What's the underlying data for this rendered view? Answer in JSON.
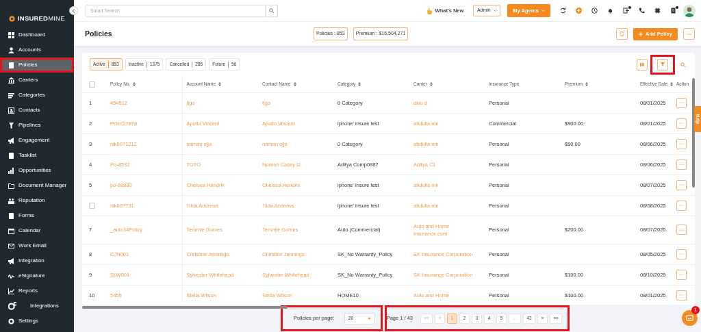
{
  "sidebar": {
    "logo": "**INSURED**MINE",
    "items": [
      {
        "label": "Dashboard",
        "selected": false,
        "highlighted": false
      },
      {
        "label": "Accounts",
        "selected": false,
        "highlighted": false
      },
      {
        "label": "Policies",
        "selected": true,
        "highlighted": true
      },
      {
        "label": "Carriers",
        "selected": false,
        "highlighted": false
      },
      {
        "label": "Categories",
        "selected": false,
        "highlighted": false
      },
      {
        "label": "Contacts",
        "selected": false,
        "highlighted": false
      },
      {
        "label": "Pipelines",
        "selected": false,
        "highlighted": false
      },
      {
        "label": "Engagement",
        "selected": false,
        "highlighted": false
      },
      {
        "label": "Tasklist",
        "selected": false,
        "highlighted": false
      },
      {
        "label": "Opportunities",
        "selected": false,
        "highlighted": false
      },
      {
        "label": "Document Manager",
        "selected": false,
        "highlighted": false
      },
      {
        "label": "Reputation",
        "selected": false,
        "highlighted": false
      },
      {
        "label": "Forms",
        "selected": false,
        "highlighted": false
      },
      {
        "label": "Calendar",
        "selected": false,
        "highlighted": false
      },
      {
        "label": "Work Email",
        "selected": false,
        "highlighted": false
      },
      {
        "label": "Integration",
        "selected": false,
        "highlighted": false
      },
      {
        "label": "eSignature",
        "selected": false,
        "highlighted": false
      },
      {
        "label": "Reports",
        "selected": false,
        "highlighted": false
      },
      {
        "label": "Integrations",
        "selected": false,
        "highlighted": false
      },
      {
        "label": "Settings",
        "selected": false,
        "highlighted": false
      }
    ]
  },
  "topbar": {
    "search": {
      "placeholder": "Smart Search"
    },
    "whats_new": "What's New",
    "role": "Admin",
    "agents_button": "My Agents",
    "notification_dots": [
      false,
      false,
      false,
      false,
      true,
      false,
      false,
      true
    ]
  },
  "header": {
    "title": "Policies",
    "stats": [
      "Policies : 853",
      "Premium : $16,504,271"
    ],
    "add_button": "Add Policy"
  },
  "status_tabs": [
    {
      "label": "Active",
      "count": "853",
      "selected": true
    },
    {
      "label": "Inactive",
      "count": "1375",
      "selected": false
    },
    {
      "label": "Cancelled",
      "count": "285",
      "selected": false
    },
    {
      "label": "Future",
      "count": "56",
      "selected": false
    }
  ],
  "filter_highlighted": true,
  "table": {
    "select_all": {
      "checked": false
    },
    "columns": [
      {
        "label": "Policy No.",
        "sortable": true
      },
      {
        "label": "Account Name",
        "sortable": true
      },
      {
        "label": "Contact Name",
        "sortable": true
      },
      {
        "label": "Category",
        "sortable": true
      },
      {
        "label": "Carrier",
        "sortable": true
      },
      {
        "label": "Insurance Type",
        "sortable": false
      },
      {
        "label": "Premium",
        "sortable": true
      },
      {
        "label": "Effective Date",
        "sortable": true
      },
      {
        "label": "Action",
        "sortable": false
      }
    ],
    "rows": [
      {
        "kind": "number",
        "num": "1",
        "policy": "454512",
        "account": "figo",
        "contact": "figo",
        "category": "0 Category",
        "carrier": "diku d",
        "type": "Personal",
        "premium": "",
        "date": "08/01/2025"
      },
      {
        "kind": "number",
        "num": "2",
        "policy": "POLCI7878",
        "account": "Apollo Vincent",
        "contact": "Apollo Vincent",
        "category": "iphone' insure test",
        "carrier": "abdulla mir",
        "type": "Commercial",
        "premium": "$900.00",
        "date": "08/01/2025"
      },
      {
        "kind": "number",
        "num": "3",
        "policy": "nik0071212",
        "account": "naman ojja",
        "contact": "naman ojja",
        "category": "0 Category",
        "carrier": "abdulla mir",
        "type": "Personal",
        "premium": "$90.00",
        "date": "08/06/2025"
      },
      {
        "kind": "number",
        "num": "4",
        "policy": "Po-8532",
        "account": "TOTO",
        "contact": "Noreen Casey st",
        "category": "Aditya Comp0987",
        "carrier": "Aditya C1",
        "type": "Personal",
        "premium": "",
        "date": "08/06/2025"
      },
      {
        "kind": "number",
        "num": "5",
        "policy": "po-08883",
        "account": "Chelsea Hendrix",
        "contact": "Chelsea Hendrix",
        "category": "iphone' insure test",
        "carrier": "abdulla mir",
        "type": "Personal",
        "premium": "",
        "date": "08/07/2025"
      },
      {
        "kind": "checkbox",
        "checked": false,
        "policy": "nik007731",
        "account": "Tilda Andrews",
        "contact": "Tilda Andrews",
        "category": "iphone' insure test",
        "carrier": "abdulla mir",
        "type": "Personal",
        "premium": "",
        "date": "08/08/2025"
      },
      {
        "kind": "number",
        "num": "7",
        "policy": "_auto34Policy",
        "account": "Temmie Gomes",
        "contact": "Temmie Gomes",
        "category": "Auto (Commercial)",
        "carrier": "Auto and Home\nInsurance.com",
        "type": "Personal",
        "premium": "$200.00",
        "date": "08/07/2025"
      },
      {
        "kind": "number",
        "num": "8",
        "policy": "CJN001",
        "account": "Christine Jennings",
        "contact": "Christine Jennings",
        "category": "SK_No Warranty_Policy",
        "carrier": "SK Insurance Corporation",
        "type": "Personal",
        "premium": "",
        "date": "08/05/2025"
      },
      {
        "kind": "number",
        "num": "9",
        "policy": "SLW001",
        "account": "Sylvester Whitehead",
        "contact": "Sylvester Whitehead",
        "category": "SK_No Warranty_Policy",
        "carrier": "SK Insurance Corporation",
        "type": "Personal",
        "premium": "$100.00",
        "date": "08/10/2025"
      },
      {
        "kind": "number",
        "num": "10",
        "policy": "5455",
        "account": "Stella Wilson",
        "contact": "Stella Wilson",
        "category": "HOME10",
        "carrier": "Auto and Home",
        "type": "Personal",
        "premium": "$100.00",
        "date": "08/01/2025"
      }
    ]
  },
  "footer": {
    "per_page_label": "Policies per page:",
    "per_page": "20",
    "page_info": "Page 1 / 43",
    "pages": [
      {
        "label": "««",
        "selected": false,
        "disabled": true
      },
      {
        "label": "«",
        "selected": false,
        "disabled": true
      },
      {
        "label": "1",
        "selected": true,
        "disabled": false
      },
      {
        "label": "2",
        "selected": false,
        "disabled": false
      },
      {
        "label": "3",
        "selected": false,
        "disabled": false
      },
      {
        "label": "4",
        "selected": false,
        "disabled": false
      },
      {
        "label": "5",
        "selected": false,
        "disabled": false
      },
      {
        "label": "...",
        "selected": false,
        "disabled": true
      },
      {
        "label": "43",
        "selected": false,
        "disabled": false
      },
      {
        "label": "»",
        "selected": false,
        "disabled": false
      },
      {
        "label": "»»",
        "selected": false,
        "disabled": false
      }
    ],
    "per_page_highlighted": true,
    "pagination_highlighted": true
  },
  "help_tab": "Help",
  "chat_badge": "1"
}
